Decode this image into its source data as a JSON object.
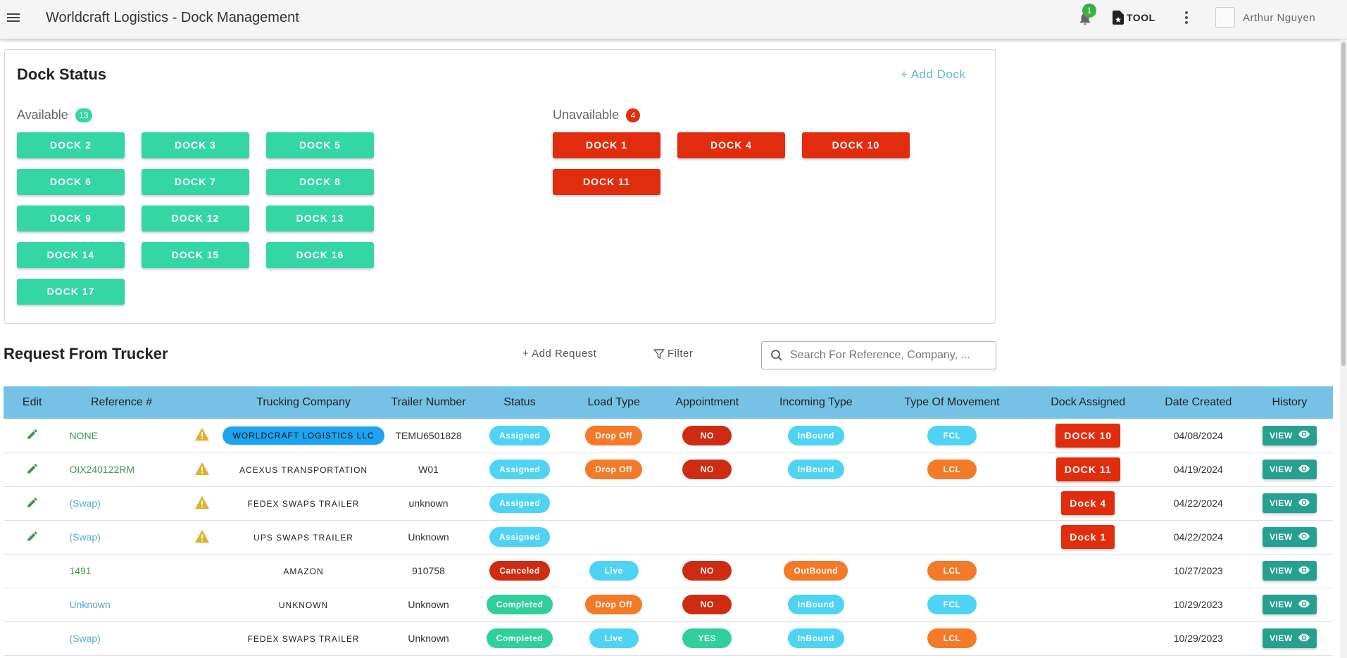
{
  "app": {
    "title": "Worldcraft Logistics - Dock Management"
  },
  "topbar": {
    "notification_count": "1",
    "tool_label": "TOOL",
    "user_name": "Arthur Nguyen"
  },
  "dock_status": {
    "title": "Dock Status",
    "add_dock_label": "+ Add Dock",
    "available_label": "Available",
    "available_count": "13",
    "available_docks": [
      "DOCK 2",
      "DOCK 3",
      "DOCK 5",
      "DOCK 6",
      "DOCK 7",
      "DOCK 8",
      "DOCK 9",
      "DOCK 12",
      "DOCK 13",
      "DOCK 14",
      "DOCK 15",
      "DOCK 16",
      "DOCK 17"
    ],
    "unavailable_label": "Unavailable",
    "unavailable_count": "4",
    "unavailable_docks": [
      "DOCK 1",
      "DOCK 4",
      "DOCK 10",
      "DOCK 11"
    ]
  },
  "requests": {
    "title": "Request From Trucker",
    "add_request_label": "+ Add Request",
    "filter_label": "Filter",
    "search_placeholder": "Search For Reference, Company, ...",
    "columns": [
      "Edit",
      "Reference #",
      "",
      "Trucking Company",
      "Trailer Number",
      "Status",
      "Load Type",
      "Appointment",
      "Incoming Type",
      "Type Of Movement",
      "Dock Assigned",
      "Date Created",
      "History"
    ],
    "view_label": "VIEW",
    "rows": [
      {
        "ref": "NONE",
        "ref_color": "green",
        "editable": true,
        "warn": true,
        "company": "WORLDCRAFT LOGISTICS LLC",
        "company_pill": true,
        "trailer": "TEMU6501828",
        "status": "Assigned",
        "load": "Drop Off",
        "appt": "NO",
        "incoming": "InBound",
        "movement": "FCL",
        "dock": "DOCK 10",
        "date": "04/08/2024"
      },
      {
        "ref": "OIX240122RM",
        "ref_color": "green",
        "editable": true,
        "warn": true,
        "company": "ACEXUS TRANSPORTATION",
        "company_pill": false,
        "trailer": "W01",
        "status": "Assigned",
        "load": "Drop Off",
        "appt": "NO",
        "incoming": "InBound",
        "movement": "LCL",
        "dock": "DOCK 11",
        "date": "04/19/2024"
      },
      {
        "ref": "(Swap)",
        "ref_color": "blue",
        "editable": true,
        "warn": true,
        "company": "FEDEX SWAPS TRAILER",
        "company_pill": false,
        "trailer": "unknown",
        "status": "Assigned",
        "load": "",
        "appt": "",
        "incoming": "",
        "movement": "",
        "dock": "Dock 4",
        "date": "04/22/2024"
      },
      {
        "ref": "(Swap)",
        "ref_color": "blue",
        "editable": true,
        "warn": true,
        "company": "UPS SWAPS TRAILER",
        "company_pill": false,
        "trailer": "Unknown",
        "status": "Assigned",
        "load": "",
        "appt": "",
        "incoming": "",
        "movement": "",
        "dock": "Dock 1",
        "date": "04/22/2024"
      },
      {
        "ref": "1491",
        "ref_color": "green",
        "editable": false,
        "warn": false,
        "company": "AMAZON",
        "company_pill": false,
        "trailer": "910758",
        "status": "Canceled",
        "load": "Live",
        "appt": "NO",
        "incoming": "OutBound",
        "movement": "LCL",
        "dock": "",
        "date": "10/27/2023"
      },
      {
        "ref": "Unknown",
        "ref_color": "blue",
        "editable": false,
        "warn": false,
        "company": "UNKNOWN",
        "company_pill": false,
        "trailer": "Unknown",
        "status": "Completed",
        "load": "Drop Off",
        "appt": "NO",
        "incoming": "InBound",
        "movement": "FCL",
        "dock": "",
        "date": "10/29/2023"
      },
      {
        "ref": "(Swap)",
        "ref_color": "blue",
        "editable": false,
        "warn": false,
        "company": "FEDEX SWAPS TRAILER",
        "company_pill": false,
        "trailer": "Unknown",
        "status": "Completed",
        "load": "Live",
        "appt": "YES",
        "incoming": "InBound",
        "movement": "LCL",
        "dock": "",
        "date": "10/29/2023"
      }
    ]
  },
  "colors": {
    "available": "#34d6a4",
    "unavailable": "#e12d0e",
    "header": "#75c2e6",
    "cyan": "#4fd3f3",
    "orange": "#f47a2a",
    "red": "#cd2b12",
    "green": "#30cf9c",
    "view": "#26a08f"
  },
  "icons": {
    "menu": "hamburger-icon",
    "bell": "bell-icon",
    "tool": "file-star-icon",
    "more": "vertical-dots-icon",
    "edit": "pencil-icon",
    "warn": "warning-icon",
    "view": "eye-icon",
    "search": "search-icon",
    "filter": "funnel-icon"
  }
}
